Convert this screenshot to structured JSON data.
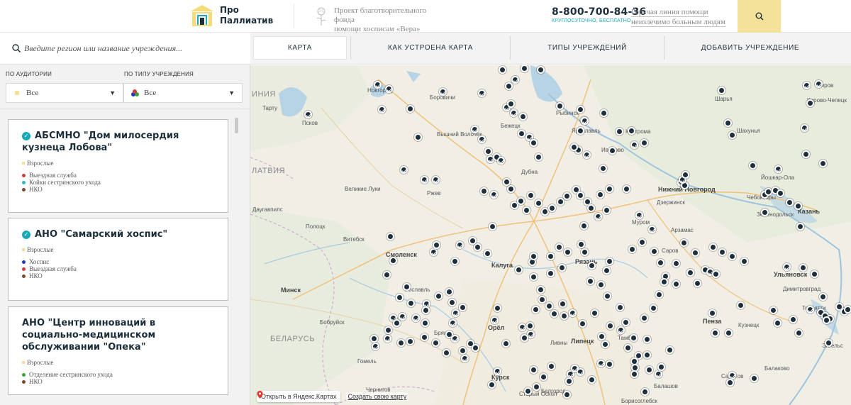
{
  "header": {
    "logo_line1": "Про",
    "logo_line2": "Паллиатив",
    "fund_line1": "Проект благотворительного фонда",
    "fund_line2": "помощи хосписам «Вера»",
    "phone": "8-800-700-84-36",
    "phone_sub": "КРУГЛОСУТОЧНО, БЕСПЛАТНО",
    "hotline_line1": "Горячая линия помощи",
    "hotline_line2": "неизлечимо больным людям",
    "search_icon": "search-icon"
  },
  "sidebar": {
    "search_placeholder": "Введите регион или название учреждения...",
    "filter_audience_label": "ПО АУДИТОРИИ",
    "filter_type_label": "ПО ТИПУ УЧРЕЖДЕНИЯ",
    "audience_value": "Все",
    "type_value": "Все",
    "cards": [
      {
        "title": "АБСМНО \"Дом милосердия кузнеца Лобова\"",
        "verified": true,
        "audience": "Взрослые",
        "services": [
          {
            "label": "Выездная служба",
            "color": "#d23b3b"
          },
          {
            "label": "Койки сестринского ухода",
            "color": "#27c0b6"
          },
          {
            "label": "НКО",
            "color": "#7a4a2a"
          }
        ]
      },
      {
        "title": "АНО \"Самарский хоспис\"",
        "verified": true,
        "audience": "Взрослые",
        "services": [
          {
            "label": "Хоспис",
            "color": "#2233cc"
          },
          {
            "label": "Выездная служба",
            "color": "#d23b3b"
          },
          {
            "label": "НКО",
            "color": "#7a4a2a"
          }
        ]
      },
      {
        "title": "АНО \"Центр инноваций в социально-медицинском обслуживании \"Опека\"",
        "verified": false,
        "audience": "Взрослые",
        "services": [
          {
            "label": "Отделение сестринского ухода",
            "color": "#3aa335"
          },
          {
            "label": "НКО",
            "color": "#7a4a2a"
          }
        ]
      }
    ]
  },
  "tabs": [
    "КАРТА",
    "КАК УСТРОЕНА КАРТА",
    "ТИПЫ УЧРЕЖДЕНИЙ",
    "ДОБАВИТЬ УЧРЕЖДЕНИЕ"
  ],
  "map": {
    "countries": [
      "ИНИЯ",
      "ЛАТВИЯ",
      "БЕЛАРУСЬ"
    ],
    "cities": [
      "Новгород",
      "Тарту",
      "Псков",
      "Боровичи",
      "Вышний Волочек",
      "Бежецк",
      "Рыбинск",
      "Ярославль",
      "Кострома",
      "Шарья",
      "Шахунья",
      "Киров",
      "Кирово-Чепецк",
      "Иваново",
      "Дубна",
      "Ржев",
      "Великие Луки",
      "Даугавпилс",
      "Полоцк",
      "Витебск",
      "Смоленск",
      "Минск",
      "Бобруйск",
      "Гомель",
      "Чернигов",
      "Калуга",
      "Рязань",
      "Орёл",
      "Курск",
      "Брянск",
      "Рославль",
      "Ливны",
      "Липецк",
      "Тамбов",
      "Старый Оскол",
      "Белгород",
      "Балашов",
      "Борисоглебск",
      "Нижний Новгород",
      "Дзержинск",
      "Муром",
      "Арзамас",
      "Саров",
      "Пенза",
      "Кузнецк",
      "Ульяновск",
      "Казань",
      "Зеленодольск",
      "Йошкар-Ола",
      "Чебоксары",
      "Димитровград",
      "Тольятти",
      "Балаково",
      "Саратов",
      "Энгельс"
    ],
    "open_yandex": "Открыть в Яндекс.Картах",
    "create_map": "Создать свою карту"
  }
}
